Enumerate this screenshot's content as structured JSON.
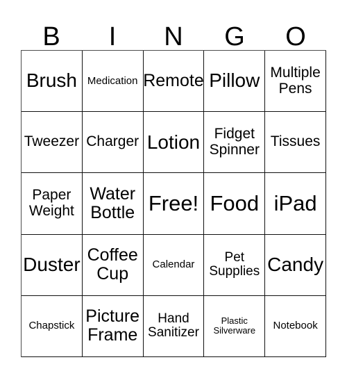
{
  "card": {
    "title": "Bingo Card",
    "background_color": "#ffffff",
    "text_color": "#000000",
    "grid_line_color": "#111111"
  },
  "header": {
    "letters": [
      {
        "label": "B"
      },
      {
        "label": "I"
      },
      {
        "label": "N"
      },
      {
        "label": "G"
      },
      {
        "label": "O"
      }
    ]
  },
  "grid": {
    "rows": 5,
    "columns": 5,
    "free_space": {
      "row": 3,
      "column": 3,
      "label": "Free!"
    },
    "cells": [
      [
        {
          "label": "Brush",
          "size": "xl"
        },
        {
          "label": "Medication",
          "size": "xs"
        },
        {
          "label": "Remote",
          "size": "lg"
        },
        {
          "label": "Pillow",
          "size": "xl"
        },
        {
          "label": "Multiple\nPens",
          "size": "md"
        }
      ],
      [
        {
          "label": "Tweezer",
          "size": "md"
        },
        {
          "label": "Charger",
          "size": "md"
        },
        {
          "label": "Lotion",
          "size": "xl"
        },
        {
          "label": "Fidget\nSpinner",
          "size": "md"
        },
        {
          "label": "Tissues",
          "size": "md"
        }
      ],
      [
        {
          "label": "Paper\nWeight",
          "size": "md"
        },
        {
          "label": "Water\nBottle",
          "size": "lg"
        },
        {
          "label": "Free!",
          "size": "xxl"
        },
        {
          "label": "Food",
          "size": "xxl"
        },
        {
          "label": "iPad",
          "size": "xxl"
        }
      ],
      [
        {
          "label": "Duster",
          "size": "xl"
        },
        {
          "label": "Coffee\nCup",
          "size": "lg"
        },
        {
          "label": "Calendar",
          "size": "xs"
        },
        {
          "label": "Pet\nSupplies",
          "size": "sm"
        },
        {
          "label": "Candy",
          "size": "xl"
        }
      ],
      [
        {
          "label": "Chapstick",
          "size": "xs"
        },
        {
          "label": "Picture\nFrame",
          "size": "lg"
        },
        {
          "label": "Hand\nSanitizer",
          "size": "sm"
        },
        {
          "label": "Plastic\nSilverware",
          "size": "xxs"
        },
        {
          "label": "Notebook",
          "size": "xs"
        }
      ]
    ]
  }
}
